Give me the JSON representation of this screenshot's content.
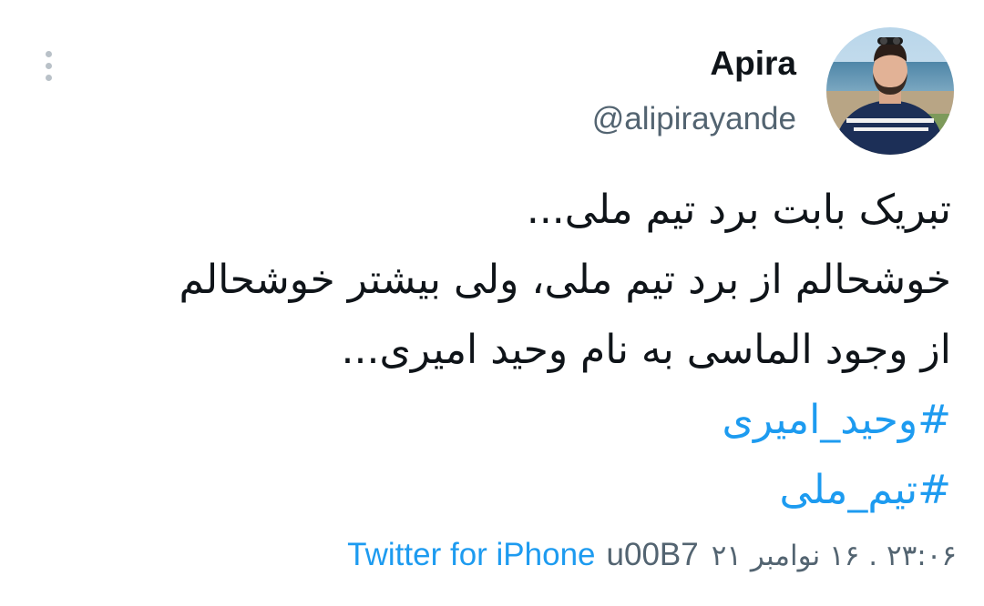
{
  "author": {
    "display_name": "Apira",
    "handle": "@alipirayande"
  },
  "more_icon": "vertical-ellipsis-icon",
  "tweet": {
    "lines": [
      "تبریک بابت برد تیم ملی...",
      "خوشحالم از برد تیم ملی، ولی بیشتر خوشحالم",
      "از وجود الماسی به نام وحید امیری..."
    ],
    "hashtags": [
      "#وحید_امیری",
      "#تیم_ملی"
    ]
  },
  "meta": {
    "timestamp": "۲۳:۰۶ . ۱۶ نوامبر ۲۱",
    "code": "u00B7",
    "source": "Twitter for iPhone"
  },
  "colors": {
    "text": "#0f1419",
    "secondary": "#536471",
    "link": "#1d9bf0"
  }
}
